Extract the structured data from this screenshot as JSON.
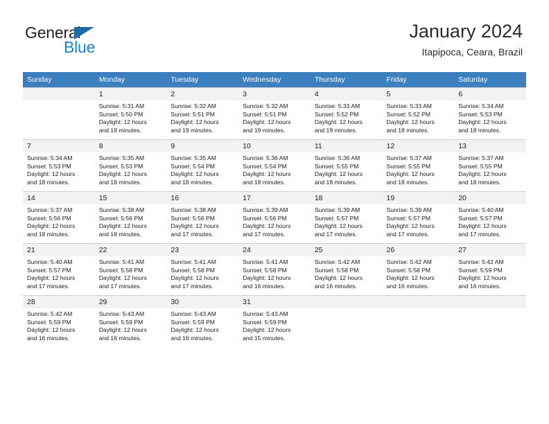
{
  "brand": {
    "name_part1": "General",
    "name_part2": "Blue",
    "accent_color": "#1f7fc4",
    "triangle_color": "#1b6ca8"
  },
  "header": {
    "title": "January 2024",
    "location": "Itapipoca, Ceara, Brazil"
  },
  "calendar": {
    "header_bg": "#3b7fbf",
    "daynum_bg": "#f2f2f2",
    "weekday_headers": [
      "Sunday",
      "Monday",
      "Tuesday",
      "Wednesday",
      "Thursday",
      "Friday",
      "Saturday"
    ],
    "labels": {
      "sunrise": "Sunrise:",
      "sunset": "Sunset:",
      "daylight": "Daylight:"
    },
    "weeks": [
      [
        {
          "day": "",
          "sunrise": "",
          "sunset": "",
          "daylight_line1": "",
          "daylight_line2": ""
        },
        {
          "day": "1",
          "sunrise": "Sunrise: 5:31 AM",
          "sunset": "Sunset: 5:50 PM",
          "daylight_line1": "Daylight: 12 hours",
          "daylight_line2": "and 19 minutes."
        },
        {
          "day": "2",
          "sunrise": "Sunrise: 5:32 AM",
          "sunset": "Sunset: 5:51 PM",
          "daylight_line1": "Daylight: 12 hours",
          "daylight_line2": "and 19 minutes."
        },
        {
          "day": "3",
          "sunrise": "Sunrise: 5:32 AM",
          "sunset": "Sunset: 5:51 PM",
          "daylight_line1": "Daylight: 12 hours",
          "daylight_line2": "and 19 minutes."
        },
        {
          "day": "4",
          "sunrise": "Sunrise: 5:33 AM",
          "sunset": "Sunset: 5:52 PM",
          "daylight_line1": "Daylight: 12 hours",
          "daylight_line2": "and 19 minutes."
        },
        {
          "day": "5",
          "sunrise": "Sunrise: 5:33 AM",
          "sunset": "Sunset: 5:52 PM",
          "daylight_line1": "Daylight: 12 hours",
          "daylight_line2": "and 18 minutes."
        },
        {
          "day": "6",
          "sunrise": "Sunrise: 5:34 AM",
          "sunset": "Sunset: 5:53 PM",
          "daylight_line1": "Daylight: 12 hours",
          "daylight_line2": "and 18 minutes."
        }
      ],
      [
        {
          "day": "7",
          "sunrise": "Sunrise: 5:34 AM",
          "sunset": "Sunset: 5:53 PM",
          "daylight_line1": "Daylight: 12 hours",
          "daylight_line2": "and 18 minutes."
        },
        {
          "day": "8",
          "sunrise": "Sunrise: 5:35 AM",
          "sunset": "Sunset: 5:53 PM",
          "daylight_line1": "Daylight: 12 hours",
          "daylight_line2": "and 18 minutes."
        },
        {
          "day": "9",
          "sunrise": "Sunrise: 5:35 AM",
          "sunset": "Sunset: 5:54 PM",
          "daylight_line1": "Daylight: 12 hours",
          "daylight_line2": "and 18 minutes."
        },
        {
          "day": "10",
          "sunrise": "Sunrise: 5:36 AM",
          "sunset": "Sunset: 5:54 PM",
          "daylight_line1": "Daylight: 12 hours",
          "daylight_line2": "and 18 minutes."
        },
        {
          "day": "11",
          "sunrise": "Sunrise: 5:36 AM",
          "sunset": "Sunset: 5:55 PM",
          "daylight_line1": "Daylight: 12 hours",
          "daylight_line2": "and 18 minutes."
        },
        {
          "day": "12",
          "sunrise": "Sunrise: 5:37 AM",
          "sunset": "Sunset: 5:55 PM",
          "daylight_line1": "Daylight: 12 hours",
          "daylight_line2": "and 18 minutes."
        },
        {
          "day": "13",
          "sunrise": "Sunrise: 5:37 AM",
          "sunset": "Sunset: 5:55 PM",
          "daylight_line1": "Daylight: 12 hours",
          "daylight_line2": "and 18 minutes."
        }
      ],
      [
        {
          "day": "14",
          "sunrise": "Sunrise: 5:37 AM",
          "sunset": "Sunset: 5:56 PM",
          "daylight_line1": "Daylight: 12 hours",
          "daylight_line2": "and 18 minutes."
        },
        {
          "day": "15",
          "sunrise": "Sunrise: 5:38 AM",
          "sunset": "Sunset: 5:56 PM",
          "daylight_line1": "Daylight: 12 hours",
          "daylight_line2": "and 18 minutes."
        },
        {
          "day": "16",
          "sunrise": "Sunrise: 5:38 AM",
          "sunset": "Sunset: 5:56 PM",
          "daylight_line1": "Daylight: 12 hours",
          "daylight_line2": "and 17 minutes."
        },
        {
          "day": "17",
          "sunrise": "Sunrise: 5:39 AM",
          "sunset": "Sunset: 5:56 PM",
          "daylight_line1": "Daylight: 12 hours",
          "daylight_line2": "and 17 minutes."
        },
        {
          "day": "18",
          "sunrise": "Sunrise: 5:39 AM",
          "sunset": "Sunset: 5:57 PM",
          "daylight_line1": "Daylight: 12 hours",
          "daylight_line2": "and 17 minutes."
        },
        {
          "day": "19",
          "sunrise": "Sunrise: 5:39 AM",
          "sunset": "Sunset: 5:57 PM",
          "daylight_line1": "Daylight: 12 hours",
          "daylight_line2": "and 17 minutes."
        },
        {
          "day": "20",
          "sunrise": "Sunrise: 5:40 AM",
          "sunset": "Sunset: 5:57 PM",
          "daylight_line1": "Daylight: 12 hours",
          "daylight_line2": "and 17 minutes."
        }
      ],
      [
        {
          "day": "21",
          "sunrise": "Sunrise: 5:40 AM",
          "sunset": "Sunset: 5:57 PM",
          "daylight_line1": "Daylight: 12 hours",
          "daylight_line2": "and 17 minutes."
        },
        {
          "day": "22",
          "sunrise": "Sunrise: 5:41 AM",
          "sunset": "Sunset: 5:58 PM",
          "daylight_line1": "Daylight: 12 hours",
          "daylight_line2": "and 17 minutes."
        },
        {
          "day": "23",
          "sunrise": "Sunrise: 5:41 AM",
          "sunset": "Sunset: 5:58 PM",
          "daylight_line1": "Daylight: 12 hours",
          "daylight_line2": "and 17 minutes."
        },
        {
          "day": "24",
          "sunrise": "Sunrise: 5:41 AM",
          "sunset": "Sunset: 5:58 PM",
          "daylight_line1": "Daylight: 12 hours",
          "daylight_line2": "and 16 minutes."
        },
        {
          "day": "25",
          "sunrise": "Sunrise: 5:42 AM",
          "sunset": "Sunset: 5:58 PM",
          "daylight_line1": "Daylight: 12 hours",
          "daylight_line2": "and 16 minutes."
        },
        {
          "day": "26",
          "sunrise": "Sunrise: 5:42 AM",
          "sunset": "Sunset: 5:58 PM",
          "daylight_line1": "Daylight: 12 hours",
          "daylight_line2": "and 16 minutes."
        },
        {
          "day": "27",
          "sunrise": "Sunrise: 5:42 AM",
          "sunset": "Sunset: 5:59 PM",
          "daylight_line1": "Daylight: 12 hours",
          "daylight_line2": "and 16 minutes."
        }
      ],
      [
        {
          "day": "28",
          "sunrise": "Sunrise: 5:42 AM",
          "sunset": "Sunset: 5:59 PM",
          "daylight_line1": "Daylight: 12 hours",
          "daylight_line2": "and 16 minutes."
        },
        {
          "day": "29",
          "sunrise": "Sunrise: 5:43 AM",
          "sunset": "Sunset: 5:59 PM",
          "daylight_line1": "Daylight: 12 hours",
          "daylight_line2": "and 16 minutes."
        },
        {
          "day": "30",
          "sunrise": "Sunrise: 5:43 AM",
          "sunset": "Sunset: 5:59 PM",
          "daylight_line1": "Daylight: 12 hours",
          "daylight_line2": "and 16 minutes."
        },
        {
          "day": "31",
          "sunrise": "Sunrise: 5:43 AM",
          "sunset": "Sunset: 5:59 PM",
          "daylight_line1": "Daylight: 12 hours",
          "daylight_line2": "and 15 minutes."
        },
        {
          "day": "",
          "sunrise": "",
          "sunset": "",
          "daylight_line1": "",
          "daylight_line2": ""
        },
        {
          "day": "",
          "sunrise": "",
          "sunset": "",
          "daylight_line1": "",
          "daylight_line2": ""
        },
        {
          "day": "",
          "sunrise": "",
          "sunset": "",
          "daylight_line1": "",
          "daylight_line2": ""
        }
      ]
    ]
  }
}
